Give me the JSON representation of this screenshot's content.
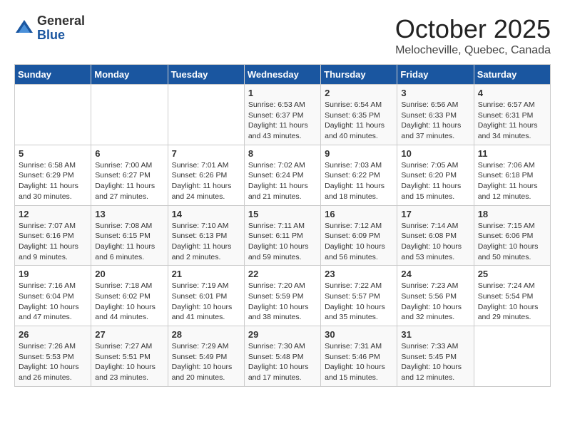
{
  "header": {
    "logo_general": "General",
    "logo_blue": "Blue",
    "title": "October 2025",
    "location": "Melocheville, Quebec, Canada"
  },
  "weekdays": [
    "Sunday",
    "Monday",
    "Tuesday",
    "Wednesday",
    "Thursday",
    "Friday",
    "Saturday"
  ],
  "weeks": [
    [
      {
        "day": "",
        "info": ""
      },
      {
        "day": "",
        "info": ""
      },
      {
        "day": "",
        "info": ""
      },
      {
        "day": "1",
        "info": "Sunrise: 6:53 AM\nSunset: 6:37 PM\nDaylight: 11 hours\nand 43 minutes."
      },
      {
        "day": "2",
        "info": "Sunrise: 6:54 AM\nSunset: 6:35 PM\nDaylight: 11 hours\nand 40 minutes."
      },
      {
        "day": "3",
        "info": "Sunrise: 6:56 AM\nSunset: 6:33 PM\nDaylight: 11 hours\nand 37 minutes."
      },
      {
        "day": "4",
        "info": "Sunrise: 6:57 AM\nSunset: 6:31 PM\nDaylight: 11 hours\nand 34 minutes."
      }
    ],
    [
      {
        "day": "5",
        "info": "Sunrise: 6:58 AM\nSunset: 6:29 PM\nDaylight: 11 hours\nand 30 minutes."
      },
      {
        "day": "6",
        "info": "Sunrise: 7:00 AM\nSunset: 6:27 PM\nDaylight: 11 hours\nand 27 minutes."
      },
      {
        "day": "7",
        "info": "Sunrise: 7:01 AM\nSunset: 6:26 PM\nDaylight: 11 hours\nand 24 minutes."
      },
      {
        "day": "8",
        "info": "Sunrise: 7:02 AM\nSunset: 6:24 PM\nDaylight: 11 hours\nand 21 minutes."
      },
      {
        "day": "9",
        "info": "Sunrise: 7:03 AM\nSunset: 6:22 PM\nDaylight: 11 hours\nand 18 minutes."
      },
      {
        "day": "10",
        "info": "Sunrise: 7:05 AM\nSunset: 6:20 PM\nDaylight: 11 hours\nand 15 minutes."
      },
      {
        "day": "11",
        "info": "Sunrise: 7:06 AM\nSunset: 6:18 PM\nDaylight: 11 hours\nand 12 minutes."
      }
    ],
    [
      {
        "day": "12",
        "info": "Sunrise: 7:07 AM\nSunset: 6:16 PM\nDaylight: 11 hours\nand 9 minutes."
      },
      {
        "day": "13",
        "info": "Sunrise: 7:08 AM\nSunset: 6:15 PM\nDaylight: 11 hours\nand 6 minutes."
      },
      {
        "day": "14",
        "info": "Sunrise: 7:10 AM\nSunset: 6:13 PM\nDaylight: 11 hours\nand 2 minutes."
      },
      {
        "day": "15",
        "info": "Sunrise: 7:11 AM\nSunset: 6:11 PM\nDaylight: 10 hours\nand 59 minutes."
      },
      {
        "day": "16",
        "info": "Sunrise: 7:12 AM\nSunset: 6:09 PM\nDaylight: 10 hours\nand 56 minutes."
      },
      {
        "day": "17",
        "info": "Sunrise: 7:14 AM\nSunset: 6:08 PM\nDaylight: 10 hours\nand 53 minutes."
      },
      {
        "day": "18",
        "info": "Sunrise: 7:15 AM\nSunset: 6:06 PM\nDaylight: 10 hours\nand 50 minutes."
      }
    ],
    [
      {
        "day": "19",
        "info": "Sunrise: 7:16 AM\nSunset: 6:04 PM\nDaylight: 10 hours\nand 47 minutes."
      },
      {
        "day": "20",
        "info": "Sunrise: 7:18 AM\nSunset: 6:02 PM\nDaylight: 10 hours\nand 44 minutes."
      },
      {
        "day": "21",
        "info": "Sunrise: 7:19 AM\nSunset: 6:01 PM\nDaylight: 10 hours\nand 41 minutes."
      },
      {
        "day": "22",
        "info": "Sunrise: 7:20 AM\nSunset: 5:59 PM\nDaylight: 10 hours\nand 38 minutes."
      },
      {
        "day": "23",
        "info": "Sunrise: 7:22 AM\nSunset: 5:57 PM\nDaylight: 10 hours\nand 35 minutes."
      },
      {
        "day": "24",
        "info": "Sunrise: 7:23 AM\nSunset: 5:56 PM\nDaylight: 10 hours\nand 32 minutes."
      },
      {
        "day": "25",
        "info": "Sunrise: 7:24 AM\nSunset: 5:54 PM\nDaylight: 10 hours\nand 29 minutes."
      }
    ],
    [
      {
        "day": "26",
        "info": "Sunrise: 7:26 AM\nSunset: 5:53 PM\nDaylight: 10 hours\nand 26 minutes."
      },
      {
        "day": "27",
        "info": "Sunrise: 7:27 AM\nSunset: 5:51 PM\nDaylight: 10 hours\nand 23 minutes."
      },
      {
        "day": "28",
        "info": "Sunrise: 7:29 AM\nSunset: 5:49 PM\nDaylight: 10 hours\nand 20 minutes."
      },
      {
        "day": "29",
        "info": "Sunrise: 7:30 AM\nSunset: 5:48 PM\nDaylight: 10 hours\nand 17 minutes."
      },
      {
        "day": "30",
        "info": "Sunrise: 7:31 AM\nSunset: 5:46 PM\nDaylight: 10 hours\nand 15 minutes."
      },
      {
        "day": "31",
        "info": "Sunrise: 7:33 AM\nSunset: 5:45 PM\nDaylight: 10 hours\nand 12 minutes."
      },
      {
        "day": "",
        "info": ""
      }
    ]
  ]
}
